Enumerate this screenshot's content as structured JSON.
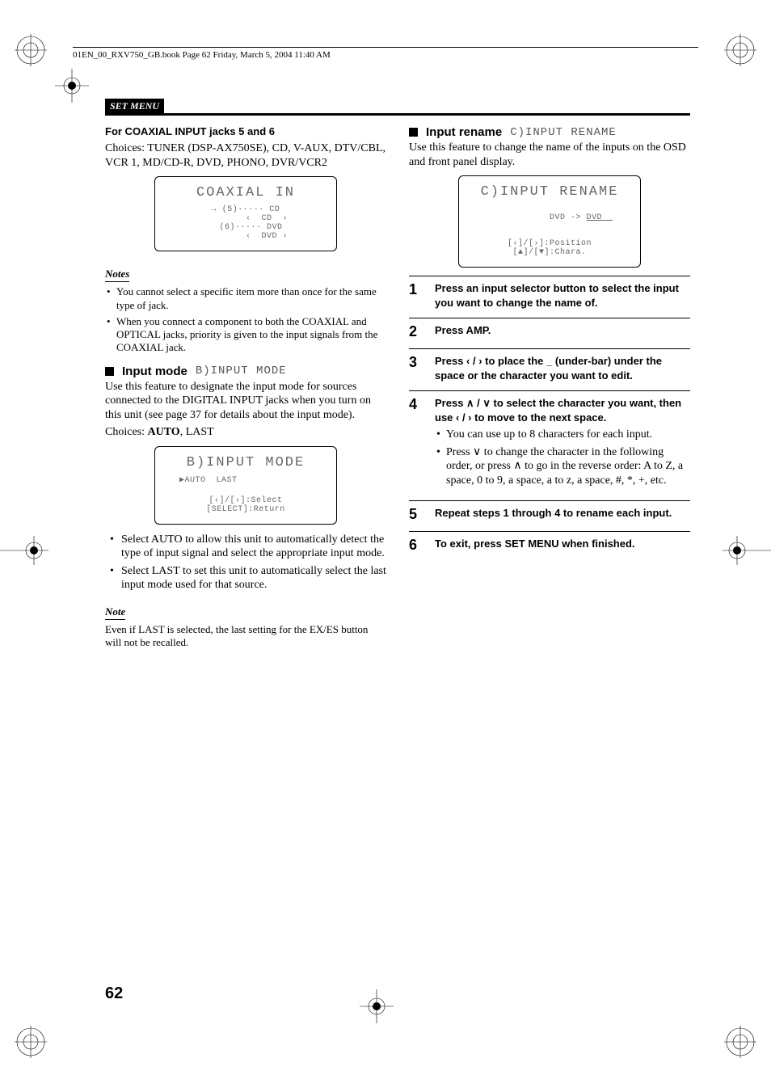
{
  "header": {
    "bookmark": "01EN_00_RXV750_GB.book  Page 62  Friday, March 5, 2004  11:40 AM"
  },
  "section": {
    "title": "SET MENU"
  },
  "left": {
    "coaxial": {
      "heading": "For COAXIAL INPUT jacks 5 and 6",
      "body": "Choices: TUNER (DSP-AX750SE), CD, V-AUX, DTV/CBL, VCR 1, MD/CD-R, DVD, PHONO, DVR/VCR2",
      "display_title": "COAXIAL IN",
      "display_lines": [
        "→ (5)····· CD",
        "        ‹  CD  ›",
        "  (6)····· DVD",
        "        ‹  DVD ›"
      ]
    },
    "notes1": {
      "label": "Notes",
      "items": [
        "You cannot select a specific item more than once for the same type of jack.",
        "When you connect a component to both the COAXIAL and OPTICAL jacks, priority is given to the input signals from the COAXIAL jack."
      ]
    },
    "inputmode": {
      "heading": "Input mode",
      "code": "B)INPUT MODE",
      "body1": "Use this feature to designate the input mode for sources connected to the DIGITAL INPUT jacks when you turn on this unit (see page 37 for details about the input mode).",
      "choices_prefix": "Choices: ",
      "choice_bold": "AUTO",
      "choice_rest": ", LAST",
      "display_title": "B)INPUT MODE",
      "display_line1": "▶AUTO  LAST",
      "display_hint1": "[‹]/[›]:Select",
      "display_hint2": "[SELECT]:Return",
      "bullets": [
        "Select AUTO to allow this unit to automatically detect the type of input signal and select the appropriate input mode.",
        "Select LAST to set this unit to automatically select the last input mode used for that source."
      ]
    },
    "note2": {
      "label": "Note",
      "text": "Even if LAST is selected, the last setting for the EX/ES button will not be recalled."
    }
  },
  "right": {
    "inputrename": {
      "heading": "Input rename",
      "code": "C)INPUT RENAME",
      "body": "Use this feature to change the name of the inputs on the OSD and front panel display.",
      "display_title": "C)INPUT RENAME",
      "display_line": "DVD -> ",
      "display_line_u": "DVD  ",
      "display_hint1": "[‹]/[›]:Position",
      "display_hint2": "[▲]/[▼]:Chara."
    },
    "steps": [
      {
        "n": "1",
        "text": "Press an input selector button to select the input you want to change the name of."
      },
      {
        "n": "2",
        "text": "Press AMP."
      },
      {
        "n": "3",
        "text": "Press ‹ / › to place the _ (under-bar) under the space or the character you want to edit."
      },
      {
        "n": "4",
        "text": "Press ∧ / ∨ to select the character you want, then use ‹ / › to move to the next space.",
        "bullets": [
          "You can use up to 8 characters for each input.",
          "Press ∨ to change the character in the following order, or press ∧ to go in the reverse order: A to Z, a space, 0 to 9, a space, a to z, a space, #, *, +, etc."
        ]
      },
      {
        "n": "5",
        "text": "Repeat steps 1 through 4 to rename each input."
      },
      {
        "n": "6",
        "text": "To exit, press SET MENU when finished."
      }
    ]
  },
  "pagenum": "62"
}
